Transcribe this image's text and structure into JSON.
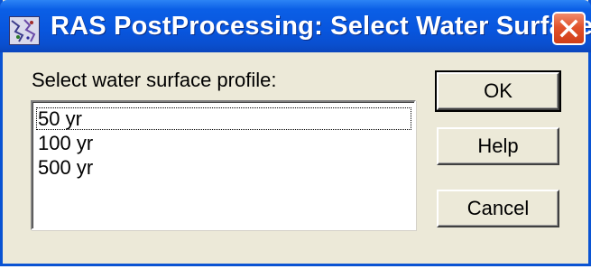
{
  "window": {
    "title": "RAS PostProcessing: Select Water Surface..."
  },
  "dialog": {
    "prompt": "Select water surface profile:",
    "profiles": [
      "50 yr",
      "100 yr",
      "500 yr"
    ]
  },
  "buttons": {
    "ok": "OK",
    "help": "Help",
    "cancel": "Cancel"
  },
  "icons": {
    "title_icon": "app-icon",
    "close_icon": "close-icon"
  },
  "colors": {
    "titlebar": "#0855dd",
    "close_button": "#e2532c",
    "dialog_face": "#ece9d8"
  }
}
